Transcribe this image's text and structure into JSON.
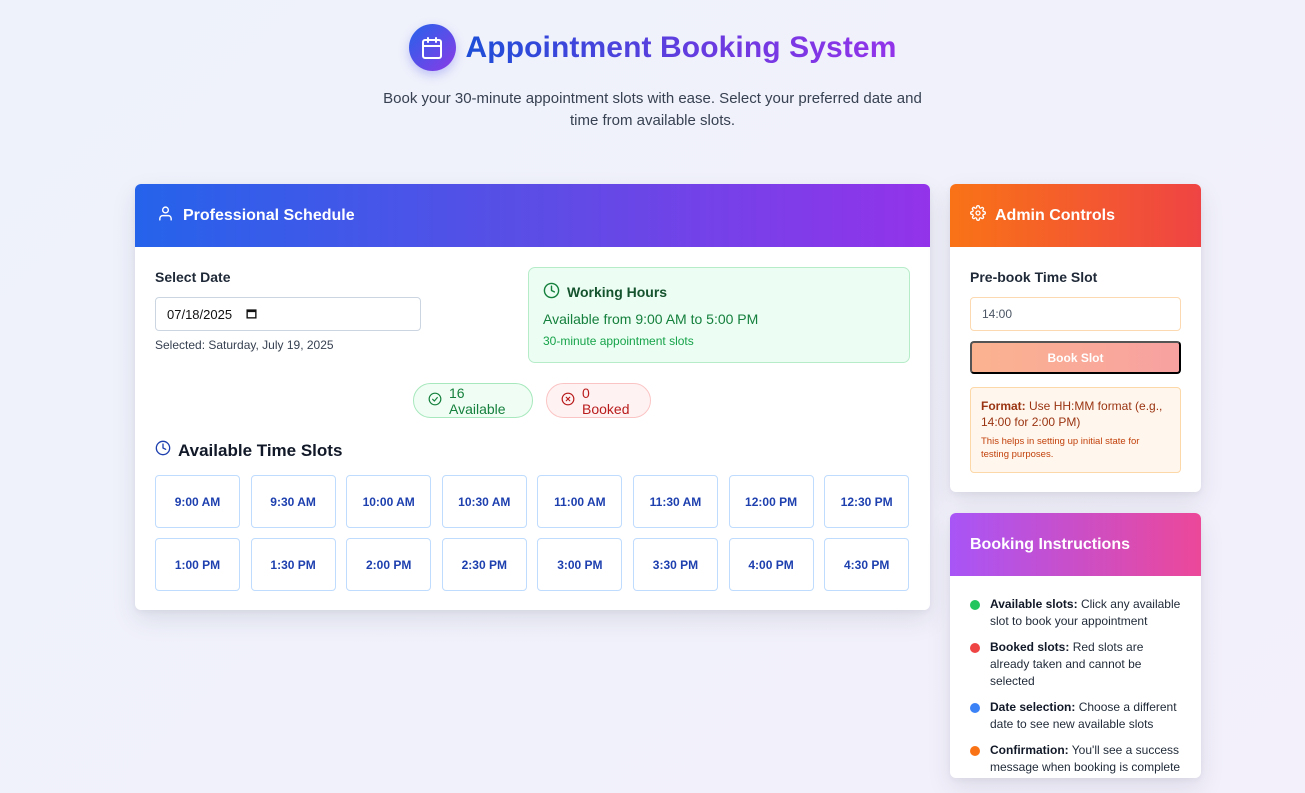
{
  "header": {
    "title": "Appointment Booking System",
    "subtitle": "Book your 30-minute appointment slots with ease. Select your preferred date and time from available slots.",
    "logo_icon": "calendar-icon"
  },
  "schedule": {
    "title": "Professional Schedule",
    "header_icon": "user-icon",
    "date_label": "Select Date",
    "date_value": "07/18/2025",
    "selected_text": "Selected: Saturday, July 19, 2025",
    "working_hours": {
      "title": "Working Hours",
      "line": "Available from 9:00 AM to 5:00 PM",
      "note": "30-minute appointment slots"
    },
    "available_pill": "16 Available",
    "booked_pill": "0 Booked",
    "slots_title": "Available Time Slots",
    "slots": [
      "9:00 AM",
      "9:30 AM",
      "10:00 AM",
      "10:30 AM",
      "11:00 AM",
      "11:30 AM",
      "12:00 PM",
      "12:30 PM",
      "1:00 PM",
      "1:30 PM",
      "2:00 PM",
      "2:30 PM",
      "3:00 PM",
      "3:30 PM",
      "4:00 PM",
      "4:30 PM"
    ]
  },
  "admin": {
    "title": "Admin Controls",
    "header_icon": "gear-icon",
    "prebook_label": "Pre-book Time Slot",
    "prebook_placeholder": "14:00",
    "book_button": "Book Slot",
    "format_label": "Format:",
    "format_text": "Use HH:MM format (e.g., 14:00 for 2:00 PM)",
    "format_note": "This helps in setting up initial state for testing purposes."
  },
  "instructions": {
    "title": "Booking Instructions",
    "items": [
      {
        "label": "Available slots:",
        "text": "Click any available slot to book your appointment",
        "color": "#22c55e"
      },
      {
        "label": "Booked slots:",
        "text": "Red slots are already taken and cannot be selected",
        "color": "#ef4444"
      },
      {
        "label": "Date selection:",
        "text": "Choose a different date to see new available slots",
        "color": "#3b82f6"
      },
      {
        "label": "Confirmation:",
        "text": "You'll see a success message when booking is complete",
        "color": "#f97316"
      }
    ]
  },
  "colors": {
    "brand_blue": "#2563eb",
    "brand_purple": "#9333ea",
    "admin_orange": "#f97316",
    "admin_red": "#ef4444",
    "success_green": "#15803d",
    "slot_text": "#1e40af"
  }
}
